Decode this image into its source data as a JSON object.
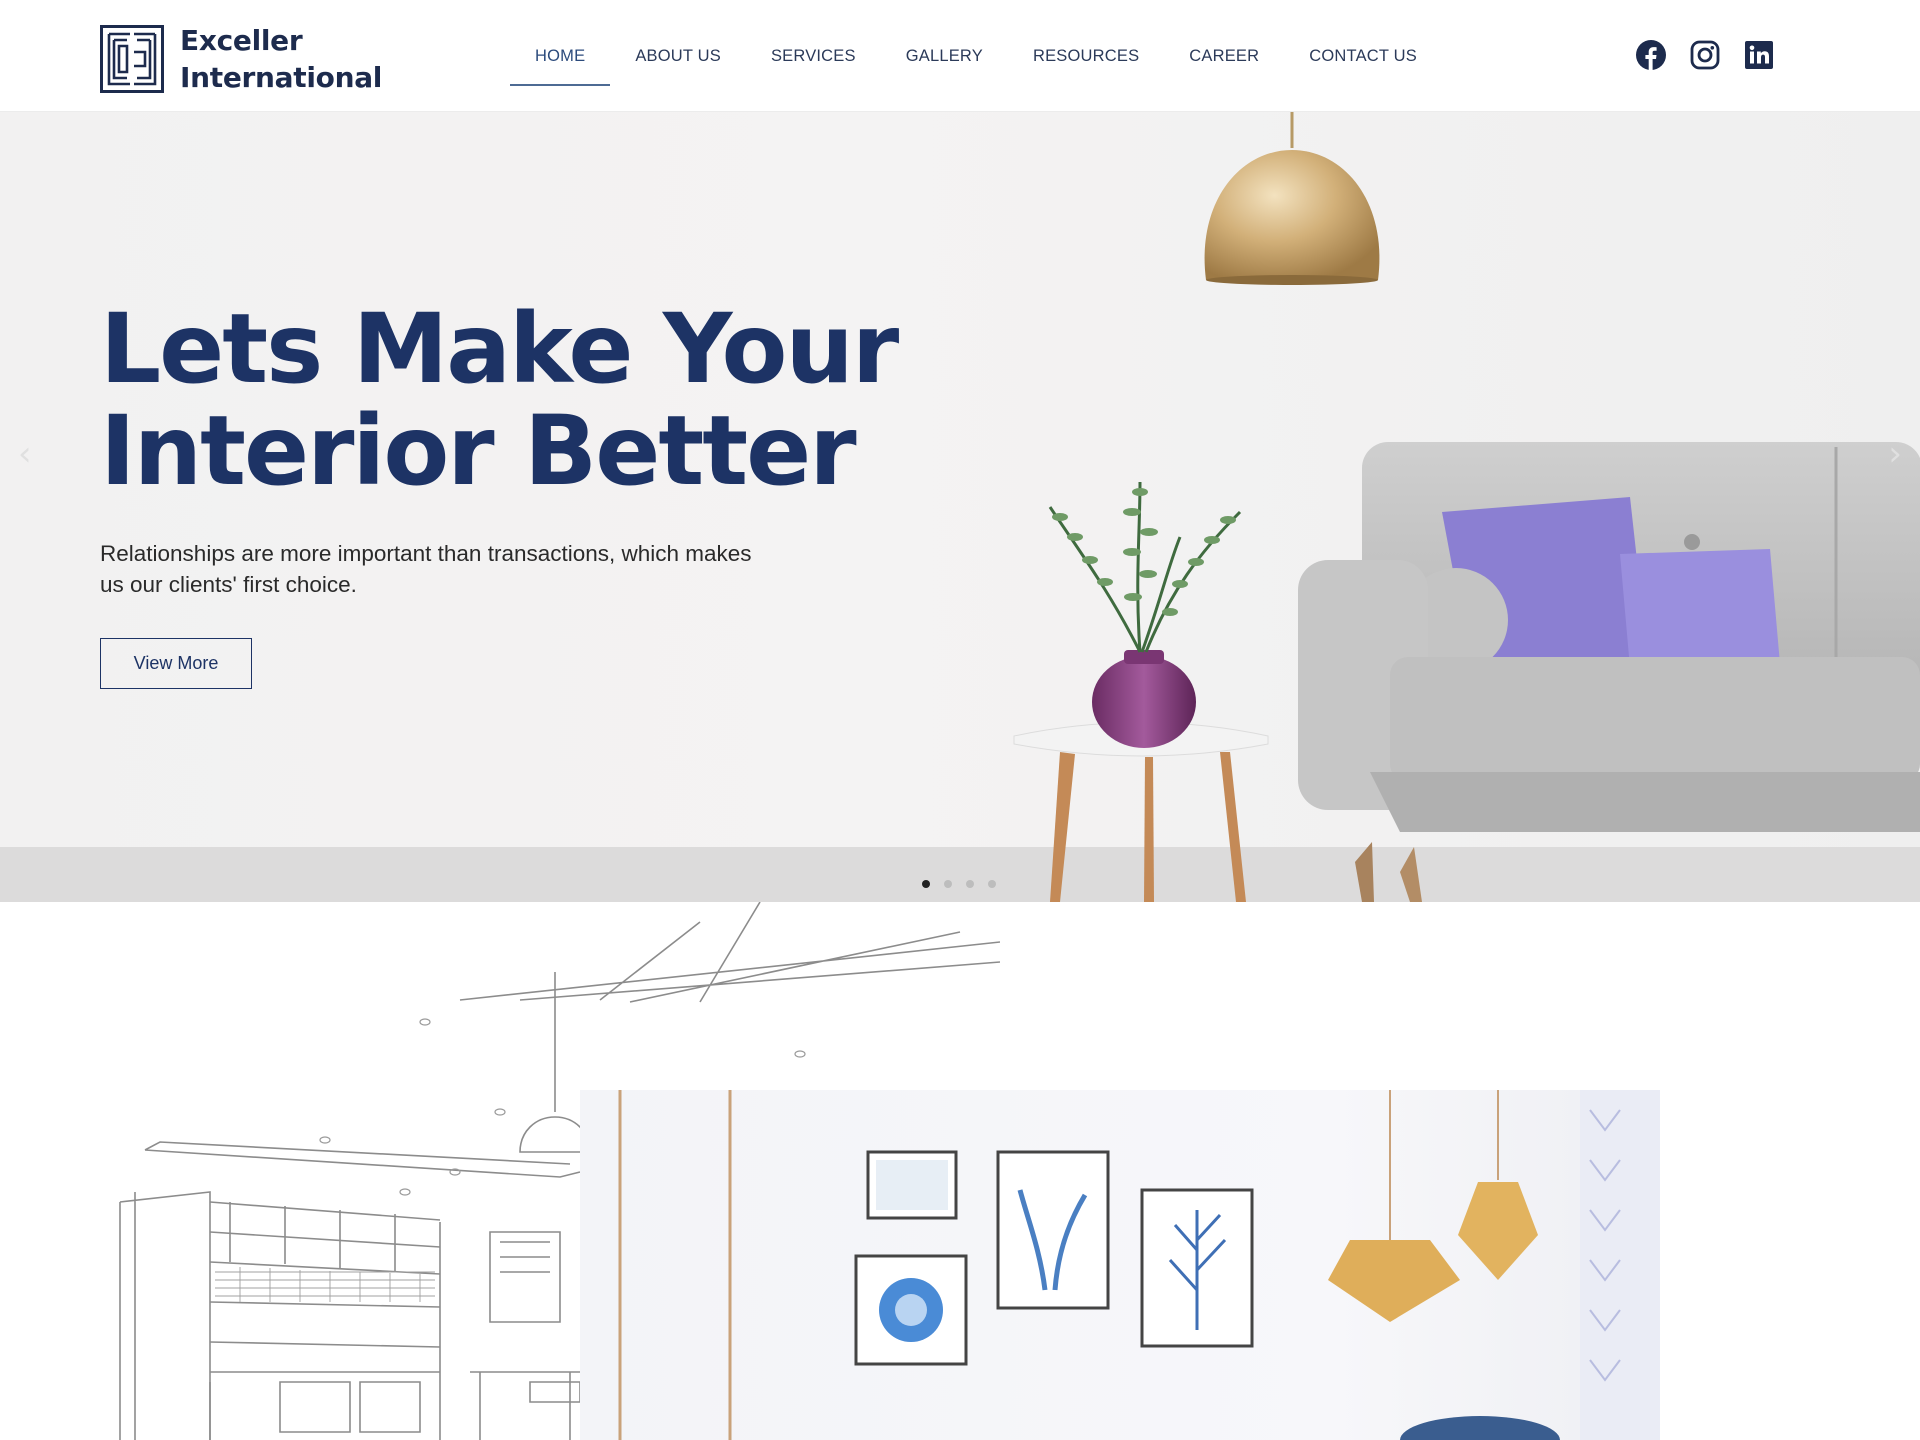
{
  "brand": {
    "line1": "Exceller",
    "line2": "International"
  },
  "nav": {
    "items": [
      {
        "label": "HOME",
        "active": true
      },
      {
        "label": "ABOUT US"
      },
      {
        "label": "SERVICES"
      },
      {
        "label": "GALLERY"
      },
      {
        "label": "RESOURCES"
      },
      {
        "label": "CAREER"
      },
      {
        "label": "CONTACT US"
      }
    ]
  },
  "social": [
    "facebook-icon",
    "instagram-icon",
    "linkedin-icon"
  ],
  "hero": {
    "title_line1": "Lets Make Your",
    "title_line2": "Interior Better",
    "subtitle": "Relationships are more important than transactions, which makes us our clients' first choice.",
    "button": "View More",
    "slides": 4,
    "active_slide": 1
  },
  "colors": {
    "brand_navy": "#1d3365",
    "nav_text": "#2b3a59",
    "sofa_pillow": "#8b7fd2",
    "lamp_gold": "#c9a66b"
  }
}
